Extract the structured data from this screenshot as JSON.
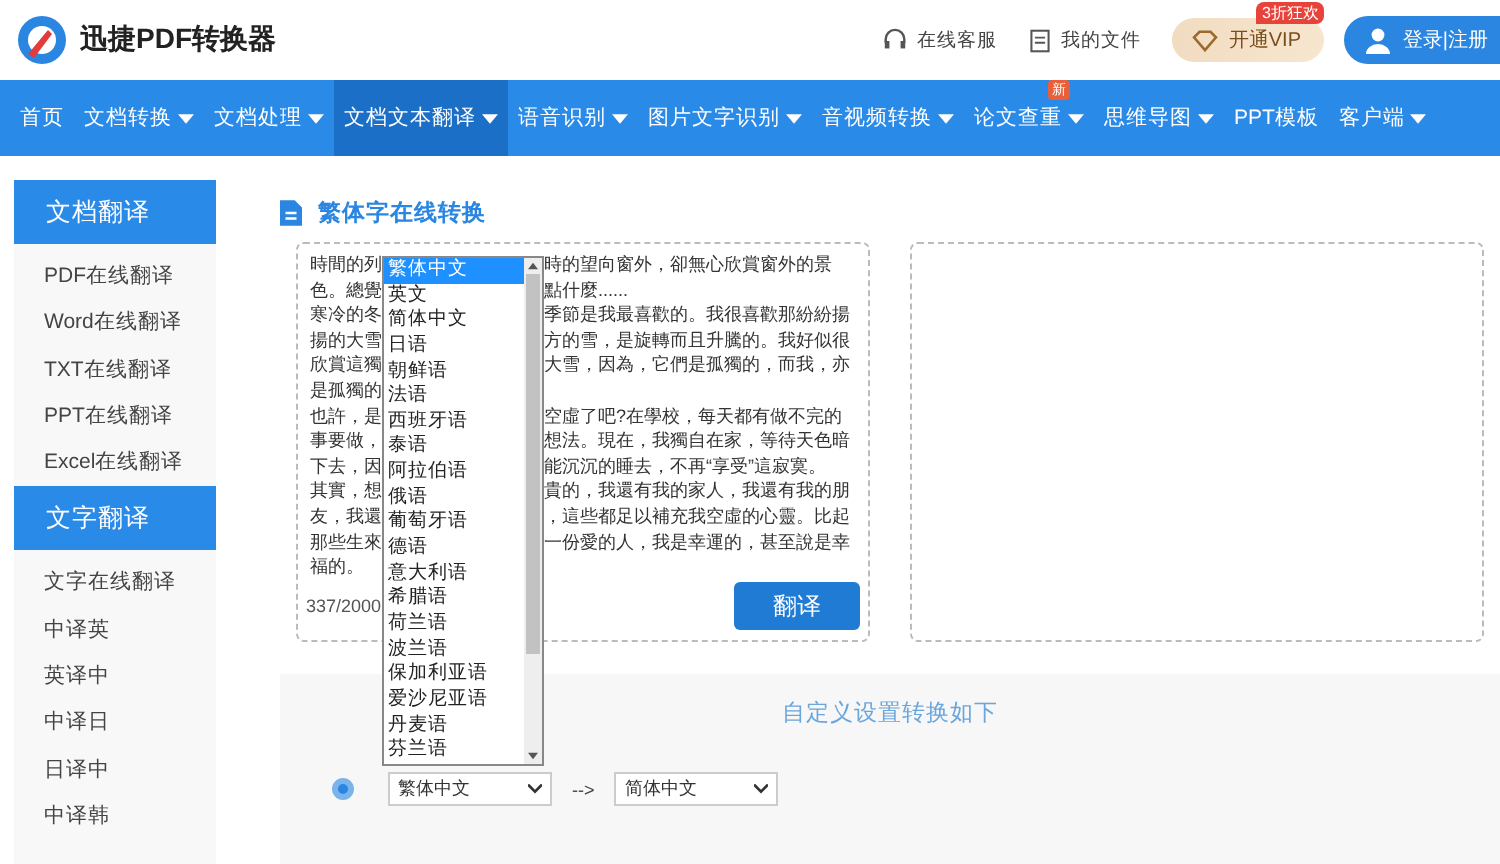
{
  "header": {
    "logo_text": "迅捷PDF转换器",
    "links": [
      {
        "label": "在线客服",
        "kind": "support"
      },
      {
        "label": "我的文件",
        "kind": "files"
      }
    ],
    "vip": {
      "label": "开通VIP",
      "badge": "3折狂欢"
    },
    "login": {
      "label": "登录|注册"
    }
  },
  "nav": [
    {
      "label": "首页",
      "selected": false,
      "dropdown": false
    },
    {
      "label": "文档转换",
      "selected": false,
      "dropdown": true
    },
    {
      "label": "文档处理",
      "selected": false,
      "dropdown": true
    },
    {
      "label": "文档文本翻译",
      "selected": true,
      "dropdown": true
    },
    {
      "label": "语音识别",
      "selected": false,
      "dropdown": true
    },
    {
      "label": "图片文字识别",
      "selected": false,
      "dropdown": true
    },
    {
      "label": "音视频转换",
      "selected": false,
      "dropdown": true
    },
    {
      "label": "论文查重",
      "selected": false,
      "dropdown": true,
      "badge": "新"
    },
    {
      "label": "思维导图",
      "selected": false,
      "dropdown": true
    },
    {
      "label": "PPT模板",
      "selected": false,
      "dropdown": false
    },
    {
      "label": "客户端",
      "selected": false,
      "dropdown": true
    }
  ],
  "sidebar": [
    {
      "heading": "文档翻译",
      "items": [
        "PDF在线翻译",
        "Word在线翻译",
        "TXT在线翻译",
        "PPT在线翻译",
        "Excel在线翻译"
      ]
    },
    {
      "heading": "文字翻译",
      "items": [
        "文字在线翻译",
        "中译英",
        "英译中",
        "中译日",
        "日译中",
        "中译韩"
      ]
    }
  ],
  "page_title": "繁体字在线转换",
  "source": {
    "lines": [
      {
        "left": "時間的列",
        "right": "時的望向窗外，卻無心欣賞窗外的景"
      },
      {
        "left": "色。總覺",
        "right": "點什麼......"
      },
      {
        "left": "寒冷的冬",
        "right": "季節是我最喜歡的。我很喜歡那紛紛揚"
      },
      {
        "left": "揚的大雪",
        "right": "方的雪，是旋轉而且升騰的。我好似很"
      },
      {
        "left": "欣賞這獨",
        "right": "大雪，因為，它們是孤獨的，而我，亦"
      },
      {
        "left": "是孤獨的"
      },
      {
        "left": "也許，是",
        "right": "空虛了吧?在學校，每天都有做不完的"
      },
      {
        "left": "事要做，",
        "right": "想法。現在，我獨自在家，等待天色暗"
      },
      {
        "left": "下去，因",
        "right": "能沉沉的睡去，不再“享受”這寂寞。"
      },
      {
        "left": "其實，想",
        "right": "貴的，我還有我的家人，我還有我的朋"
      },
      {
        "left": "友，我還",
        "right": "，這些都足以補充我空虛的心靈。比起"
      },
      {
        "left": "那些生來",
        "right": "一份愛的人，我是幸運的，甚至說是幸"
      },
      {
        "left": "福的。"
      }
    ],
    "counter": "337/2000"
  },
  "translate_button": "翻译",
  "language_list": [
    {
      "label": "繁体中文",
      "selected": true
    },
    {
      "label": "英文",
      "selected": false
    },
    {
      "label": "简体中文",
      "selected": false
    },
    {
      "label": "日语",
      "selected": false
    },
    {
      "label": "朝鲜语",
      "selected": false
    },
    {
      "label": "法语",
      "selected": false
    },
    {
      "label": "西班牙语",
      "selected": false
    },
    {
      "label": "泰语",
      "selected": false
    },
    {
      "label": "阿拉伯语",
      "selected": false
    },
    {
      "label": "俄语",
      "selected": false
    },
    {
      "label": "葡萄牙语",
      "selected": false
    },
    {
      "label": "德语",
      "selected": false
    },
    {
      "label": "意大利语",
      "selected": false
    },
    {
      "label": "希腊语",
      "selected": false
    },
    {
      "label": "荷兰语",
      "selected": false
    },
    {
      "label": "波兰语",
      "selected": false
    },
    {
      "label": "保加利亚语",
      "selected": false
    },
    {
      "label": "爱沙尼亚语",
      "selected": false
    },
    {
      "label": "丹麦语",
      "selected": false
    },
    {
      "label": "芬兰语",
      "selected": false
    }
  ],
  "settings": {
    "heading": "自定义设置转换如下",
    "radio_selected": true,
    "from": "繁体中文",
    "arrow": "-->",
    "to": "简体中文"
  }
}
